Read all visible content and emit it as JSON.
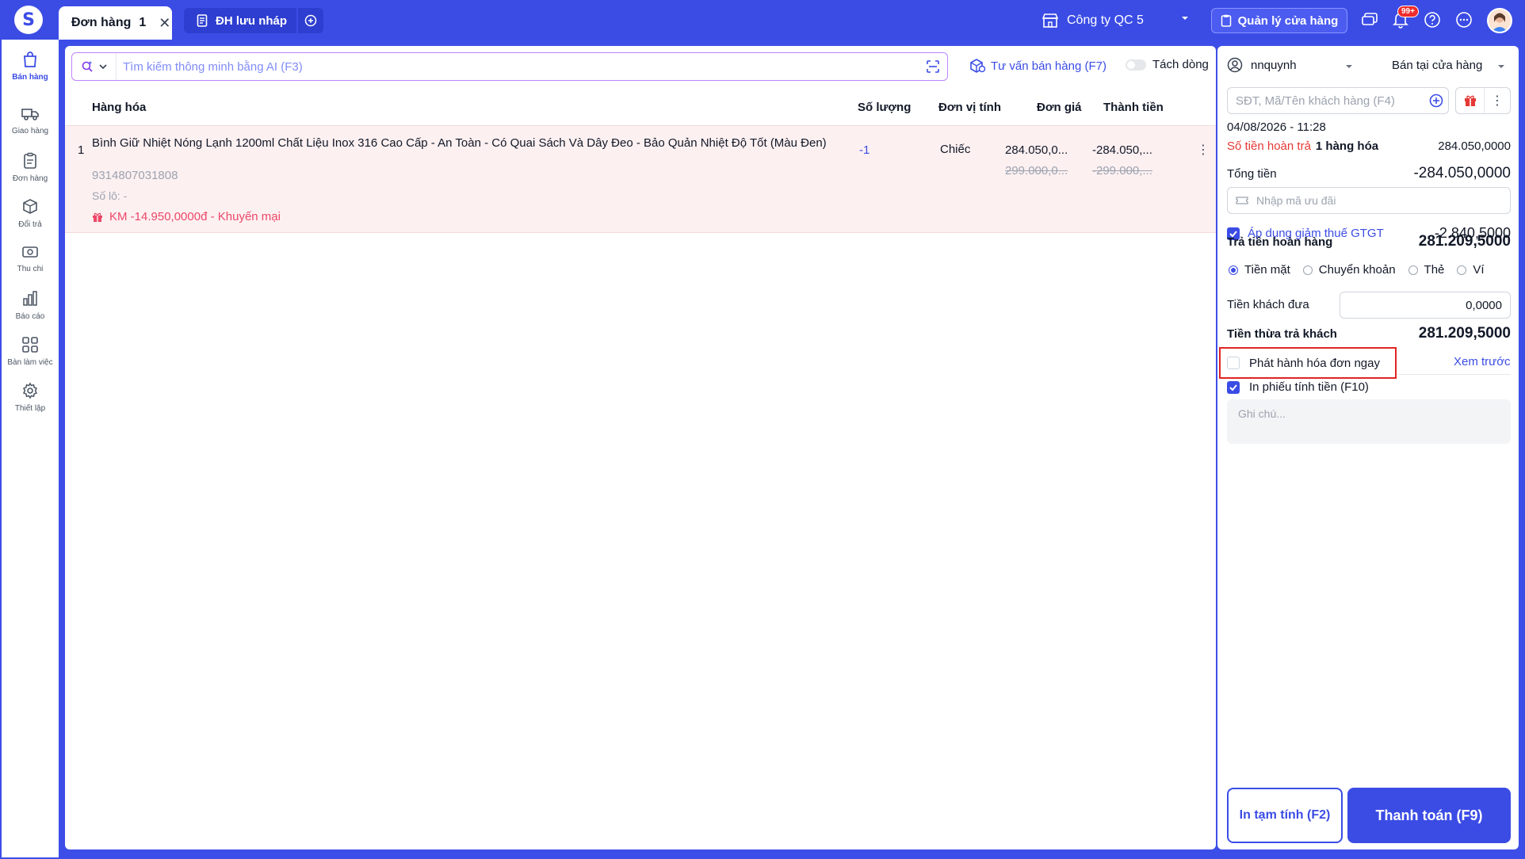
{
  "header": {
    "tab_active_label": "Đơn hàng",
    "tab_active_count": "1",
    "tab_draft_label": "ĐH lưu nháp",
    "company": "Công ty QC 5",
    "manage_store": "Quản lý cửa hàng",
    "notif_badge": "99+"
  },
  "sidebar": {
    "items": [
      {
        "label": "Bán hàng",
        "icon": "shopping-bag-icon"
      },
      {
        "label": "Giao hàng",
        "icon": "truck-icon"
      },
      {
        "label": "Đơn hàng",
        "icon": "clipboard-icon"
      },
      {
        "label": "Đổi trả",
        "icon": "box-return-icon"
      },
      {
        "label": "Thu chi",
        "icon": "cash-icon"
      },
      {
        "label": "Báo cáo",
        "icon": "bar-chart-icon"
      },
      {
        "label": "Bàn làm việc",
        "icon": "grid-icon"
      },
      {
        "label": "Thiết lập",
        "icon": "gear-icon"
      }
    ]
  },
  "main": {
    "search_placeholder": "Tìm kiếm thông minh bằng AI (F3)",
    "advise_label": "Tư vấn bán hàng (F7)",
    "split_label": "Tách dòng",
    "columns": {
      "product": "Hàng hóa",
      "qty": "Số lượng",
      "unit": "Đơn vị tính",
      "price": "Đơn giá",
      "total": "Thành tiền"
    },
    "rows": [
      {
        "index": "1",
        "name": "Bình Giữ Nhiệt Nóng Lạnh 1200ml Chất Liệu Inox 316 Cao Cấp - An Toàn - Có Quai Sách Và Dây Đeo - Bảo Quản Nhiệt Độ Tốt (Màu Đen)",
        "code": "9314807031808",
        "lot": "Số lô: -",
        "promo": "KM -14.950,0000đ - Khuyến mại",
        "qty": "-1",
        "unit": "Chiếc",
        "price": "284.050,0...",
        "price_old": "299.000,0...",
        "total": "-284.050,...",
        "total_old": "-299.000,..."
      }
    ]
  },
  "right": {
    "user": "nnquynh",
    "mode": "Bán tại cửa hàng",
    "customer_placeholder": "SĐT, Mã/Tên khách hàng (F4)",
    "datetime": "04/08/2026 - 11:28",
    "refund_label": "Số tiền hoàn trả",
    "refund_items": "1 hàng hóa",
    "refund_value": "284.050,0000",
    "total_label": "Tổng tiền",
    "total_value": "-284.050,0000",
    "voucher_placeholder": "Nhập mã ưu đãi",
    "vat_label": "Áp dụng giảm thuế GTGT",
    "vat_value": "-2.840,5000",
    "pay_refund_label": "Trả tiền hoàn hàng",
    "pay_refund_value": "281.209,5000",
    "payment_methods": [
      "Tiền mặt",
      "Chuyển khoản",
      "Thẻ",
      "Ví"
    ],
    "given_label": "Tiền khách đưa",
    "given_value": "0,0000",
    "change_label": "Tiền thừa trả khách",
    "change_value": "281.209,5000",
    "issue_invoice_label": "Phát hành hóa đơn ngay",
    "preview_label": "Xem trước",
    "print_receipt_label": "In phiếu tính tiền (F10)",
    "note_placeholder": "Ghi chú...",
    "btn_print_label": "In tạm tính (F2)",
    "btn_pay_label": "Thanh toán (F9)"
  }
}
